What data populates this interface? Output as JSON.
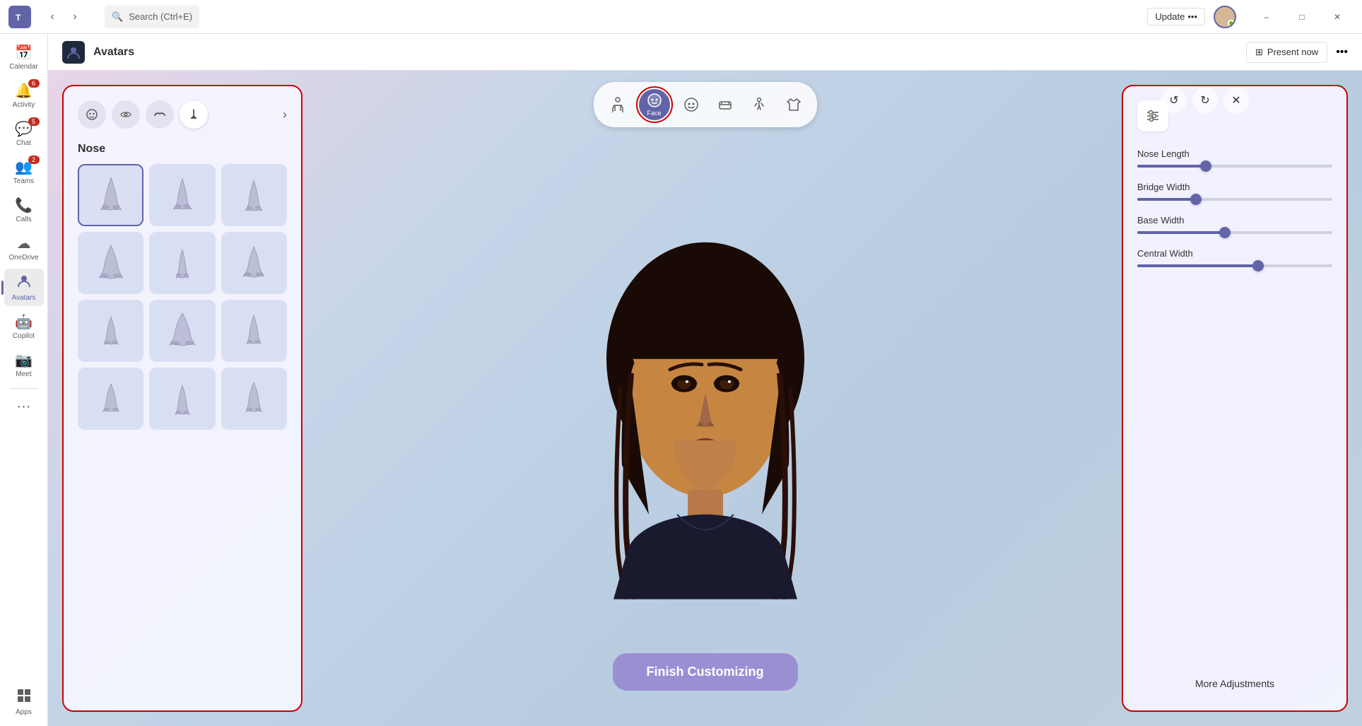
{
  "titlebar": {
    "teams_logo": "T",
    "search_placeholder": "Search (Ctrl+E)",
    "update_label": "Update",
    "update_dots": "•••",
    "min_label": "–",
    "max_label": "□",
    "close_label": "✕"
  },
  "sidebar": {
    "items": [
      {
        "id": "calendar",
        "label": "Calendar",
        "icon": "📅",
        "badge": null,
        "active": false
      },
      {
        "id": "activity",
        "label": "Activity",
        "icon": "🔔",
        "badge": "6",
        "active": false
      },
      {
        "id": "chat",
        "label": "Chat",
        "icon": "💬",
        "badge": "5",
        "active": false
      },
      {
        "id": "teams",
        "label": "Teams",
        "icon": "👥",
        "badge": "2",
        "active": false
      },
      {
        "id": "calls",
        "label": "Calls",
        "icon": "📞",
        "badge": null,
        "active": false
      },
      {
        "id": "onedrive",
        "label": "OneDrive",
        "icon": "☁",
        "badge": null,
        "active": false
      },
      {
        "id": "avatars",
        "label": "Avatars",
        "icon": "👤",
        "badge": null,
        "active": true
      },
      {
        "id": "copilot",
        "label": "Copilot",
        "icon": "🤖",
        "badge": null,
        "active": false
      },
      {
        "id": "meet",
        "label": "Meet",
        "icon": "📷",
        "badge": null,
        "active": false
      },
      {
        "id": "more",
        "label": "•••",
        "icon": "•••",
        "badge": null,
        "active": false
      },
      {
        "id": "apps",
        "label": "Apps",
        "icon": "⊞",
        "badge": null,
        "active": false
      }
    ]
  },
  "app_header": {
    "icon": "👤",
    "title": "Avatars",
    "present_label": "Present now",
    "more_label": "•••"
  },
  "toolbar": {
    "buttons": [
      {
        "id": "body",
        "icon": "🧍",
        "label": "",
        "active": false
      },
      {
        "id": "face",
        "icon": "😊",
        "label": "Face",
        "active": true
      },
      {
        "id": "expressions",
        "icon": "😄",
        "label": "",
        "active": false
      },
      {
        "id": "accessories",
        "icon": "👔",
        "label": "",
        "active": false
      },
      {
        "id": "pose",
        "icon": "🤸",
        "label": "",
        "active": false
      },
      {
        "id": "clothing",
        "icon": "👕",
        "label": "",
        "active": false
      }
    ],
    "undo_label": "↺",
    "redo_label": "↻",
    "close_label": "✕"
  },
  "left_panel": {
    "face_tabs": [
      {
        "id": "overall",
        "icon": "😊",
        "active": false
      },
      {
        "id": "eyes",
        "icon": "👁",
        "active": false
      },
      {
        "id": "eyebrows",
        "icon": "〰",
        "active": false
      },
      {
        "id": "nose",
        "icon": "👃",
        "active": true
      }
    ],
    "section_title": "Nose",
    "nose_items": [
      {
        "id": 1
      },
      {
        "id": 2
      },
      {
        "id": 3
      },
      {
        "id": 4
      },
      {
        "id": 5
      },
      {
        "id": 6
      },
      {
        "id": 7
      },
      {
        "id": 8
      },
      {
        "id": 9
      },
      {
        "id": 10
      },
      {
        "id": 11
      },
      {
        "id": 12
      }
    ]
  },
  "right_panel": {
    "sliders": [
      {
        "id": "nose_length",
        "label": "Nose Length",
        "value": 35,
        "max": 100
      },
      {
        "id": "bridge_width",
        "label": "Bridge Width",
        "value": 30,
        "max": 100
      },
      {
        "id": "base_width",
        "label": "Base Width",
        "value": 45,
        "max": 100
      },
      {
        "id": "central_width",
        "label": "Central Width",
        "value": 62,
        "max": 100
      }
    ],
    "more_label": "More Adjustments"
  },
  "finish_btn": {
    "label": "Finish Customizing"
  }
}
